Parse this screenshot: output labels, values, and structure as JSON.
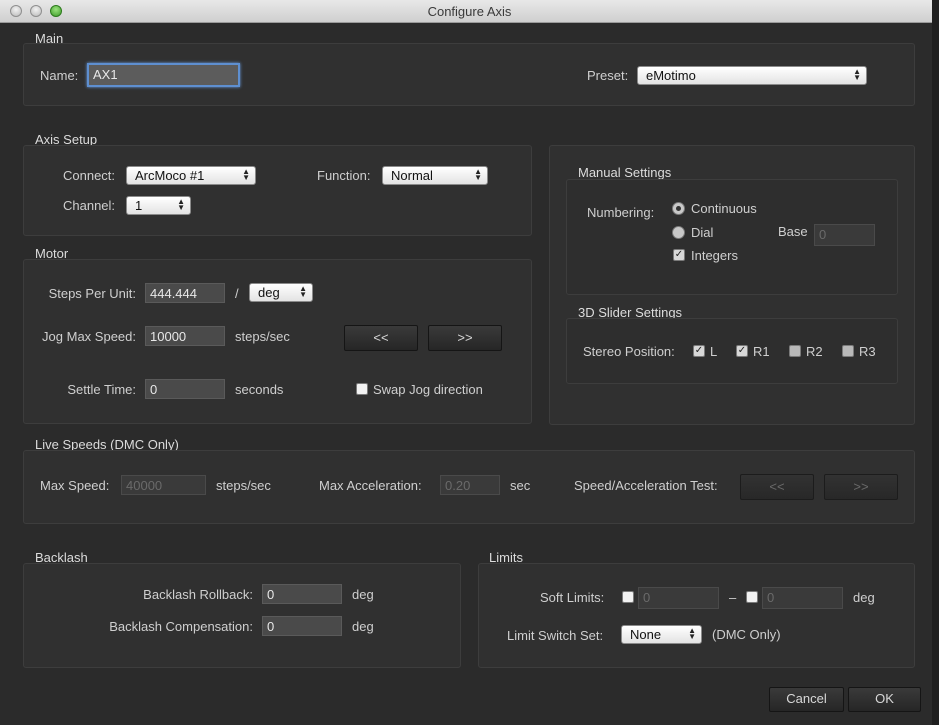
{
  "window": {
    "title": "Configure Axis"
  },
  "main": {
    "section": "Main",
    "name_label": "Name:",
    "name_value": "AX1",
    "preset_label": "Preset:",
    "preset_value": "eMotimo"
  },
  "axis_setup": {
    "section": "Axis Setup",
    "connect_label": "Connect:",
    "connect_value": "ArcMoco #1",
    "function_label": "Function:",
    "function_value": "Normal",
    "channel_label": "Channel:",
    "channel_value": "1"
  },
  "motor": {
    "section": "Motor",
    "steps_label": "Steps Per Unit:",
    "steps_value": "444.444",
    "slash": "/",
    "unit_value": "deg",
    "jog_label": "Jog Max Speed:",
    "jog_value": "10000",
    "jog_unit": "steps/sec",
    "jog_back": "<<",
    "jog_fwd": ">>",
    "settle_label": "Settle Time:",
    "settle_value": "0",
    "settle_unit": "seconds",
    "swap_label": "Swap Jog direction",
    "swap_checked": false
  },
  "manual": {
    "section": "Manual Settings",
    "numbering_label": "Numbering:",
    "opt_continuous": "Continuous",
    "opt_dial": "Dial",
    "selected": "Continuous",
    "base_label": "Base",
    "base_placeholder": "0",
    "integers_label": "Integers",
    "integers_checked": true
  },
  "slider3d": {
    "section": "3D Slider Settings",
    "stereo_label": "Stereo Position:",
    "positions": [
      {
        "label": "L",
        "checked": true
      },
      {
        "label": "R1",
        "checked": true
      },
      {
        "label": "R2",
        "checked": false
      },
      {
        "label": "R3",
        "checked": false
      }
    ]
  },
  "live": {
    "section": "Live Speeds (DMC Only)",
    "max_speed_label": "Max Speed:",
    "max_speed_value": "40000",
    "max_speed_unit": "steps/sec",
    "max_accel_label": "Max Acceleration:",
    "max_accel_value": "0.20",
    "max_accel_unit": "sec",
    "test_label": "Speed/Acceleration Test:",
    "test_back": "<<",
    "test_fwd": ">>"
  },
  "backlash": {
    "section": "Backlash",
    "rollback_label": "Backlash Rollback:",
    "rollback_value": "0",
    "rollback_unit": "deg",
    "comp_label": "Backlash Compensation:",
    "comp_value": "0",
    "comp_unit": "deg"
  },
  "limits": {
    "section": "Limits",
    "soft_label": "Soft Limits:",
    "soft_min": "0",
    "dash": "–",
    "soft_max": "0",
    "soft_unit": "deg",
    "switch_label": "Limit Switch Set:",
    "switch_value": "None",
    "switch_note": "(DMC Only)"
  },
  "footer": {
    "cancel": "Cancel",
    "ok": "OK"
  },
  "icons": {
    "checkmark": "✓",
    "up_arrow": "▲",
    "down_arrow": "▼"
  }
}
